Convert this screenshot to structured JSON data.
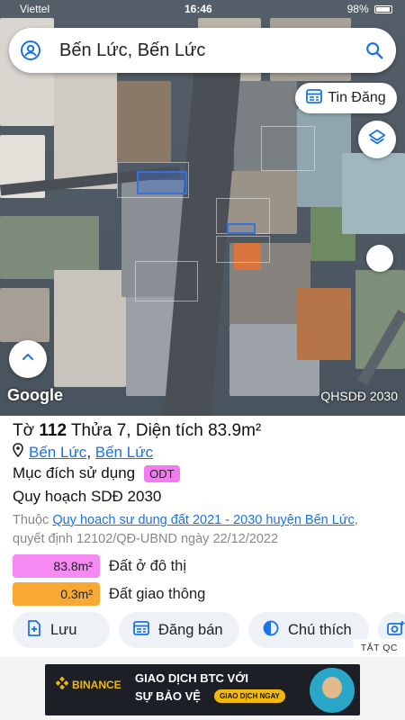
{
  "status_bar": {
    "carrier": "Viettel",
    "time": "16:46",
    "battery": "98%"
  },
  "search": {
    "query": "Bến Lức, Bến Lức"
  },
  "map": {
    "tin_dang_label": "Tin Đăng",
    "google_label": "Google",
    "overlay_label": "QHSDĐ 2030"
  },
  "parcel": {
    "to_label": "Tờ",
    "to_number": "112",
    "thua_label": "Thửa",
    "thua_number": "7",
    "area_label": "Diện tích",
    "area_value": "83.9m²",
    "location_part1": "Bến Lức",
    "location_sep": ", ",
    "location_part2": "Bến Lức",
    "purpose_label": "Mục đích sử dụng",
    "purpose_code": "ODT",
    "plan_label": "Quy hoạch SDĐ 2030",
    "belongs_prefix": "Thuộc ",
    "belongs_link": "Quy hoach sư dung đất 2021 - 2030 huyện Bến Lức",
    "belongs_suffix": ", quyết định 12102/QĐ-UBND ngày 22/12/2022",
    "usage": [
      {
        "area": "83.8m²",
        "label": "Đất ở đô thị",
        "color": "#f58af2"
      },
      {
        "area": "0.3m²",
        "label": "Đất giao thông",
        "color": "#f8a833"
      }
    ]
  },
  "actions": {
    "save": "Lưu",
    "sell": "Đăng bán",
    "note": "Chú thích"
  },
  "ad": {
    "close_label": "TẮT QC",
    "brand": "BINANCE",
    "line1": "GIAO DỊCH BTC VỚI",
    "line2": "SỰ BẢO VỆ",
    "cta": "GIAO DỊCH NGAY"
  },
  "colors": {
    "accent": "#1a73e8",
    "odt": "#f27bf1"
  }
}
